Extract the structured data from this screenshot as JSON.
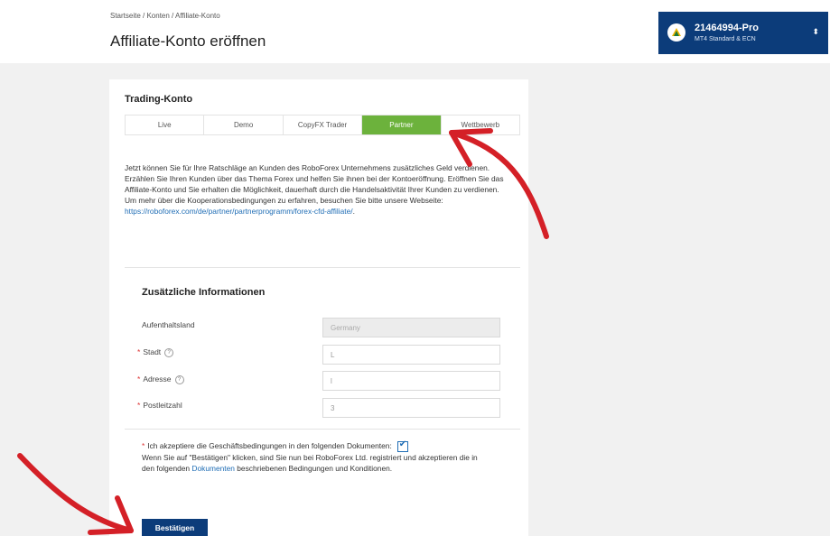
{
  "header": {
    "breadcrumb": "Startseite / Konten / Affiliate-Konto",
    "title": "Affiliate-Konto eröffnen"
  },
  "account": {
    "id": "21464994-Pro",
    "type": "MT4 Standard & ECN"
  },
  "trading": {
    "section_title": "Trading-Konto",
    "tabs": [
      {
        "label": "Live"
      },
      {
        "label": "Demo"
      },
      {
        "label": "CopyFX Trader"
      },
      {
        "label": "Partner"
      },
      {
        "label": "Wettbewerb"
      }
    ],
    "active_tab": "Partner",
    "description": "Jetzt können Sie für Ihre Ratschläge an Kunden des RoboForex Unternehmens zusätzliches Geld verdienen. Erzählen Sie Ihren Kunden über das Thema Forex und helfen Sie ihnen bei der Kontoeröffnung. Eröffnen Sie das Affiliate-Konto und Sie erhalten die Möglichkeit, dauerhaft durch die Handelsaktivität Ihrer Kunden zu verdienen. Um mehr über die Kooperationsbedingungen zu erfahren, besuchen Sie bitte unsere Webseite:",
    "link": "https://roboforex.com/de/partner/partnerprogramm/forex-cfd-affiliate/",
    "link_suffix": "."
  },
  "info": {
    "section_title": "Zusätzliche Informationen",
    "country_label": "Aufenthaltsland",
    "country_value": "Germany",
    "city_label": "Stadt",
    "city_value": "L",
    "address_label": "Adresse",
    "address_value": "l",
    "zip_label": "Postleitzahl",
    "zip_value": "3"
  },
  "terms": {
    "text": "Ich akzeptiere die Geschäftsbedingungen in den folgenden Dokumenten:",
    "checked": true,
    "note_before": "Wenn Sie auf \"Bestätigen\" klicken, sind Sie nun bei RoboForex Ltd. registriert und akzeptieren die in den folgenden",
    "note_link": "Dokumenten",
    "note_after": "beschriebenen Bedingungen und Konditionen."
  },
  "submit_label": "Bestätigen",
  "colors": {
    "primary": "#0c3c7a",
    "active_tab": "#6cb23c",
    "link": "#1f6db5",
    "annotation_arrow": "#d42027"
  }
}
